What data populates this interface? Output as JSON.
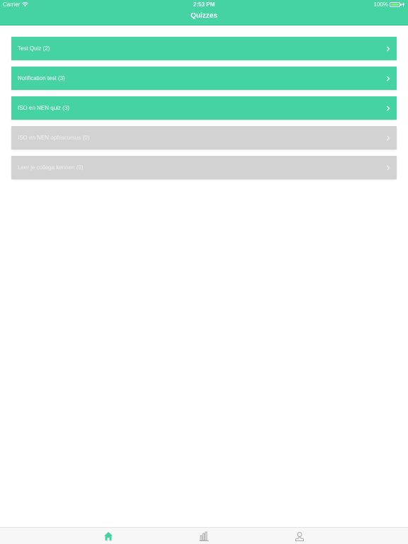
{
  "status_bar": {
    "carrier": "Carrier",
    "time": "2:53 PM",
    "battery": "100%"
  },
  "nav": {
    "title": "Quizzes"
  },
  "quizzes": [
    {
      "label": "Test Quiz (2)",
      "state": "active"
    },
    {
      "label": "Notification test (3)",
      "state": "active"
    },
    {
      "label": "ISO en NEN quiz (3)",
      "state": "active"
    },
    {
      "label": "ISO en NEN opfriscursus (0)",
      "state": "inactive"
    },
    {
      "label": "Leer je collega kennen (0)",
      "state": "inactive"
    }
  ],
  "tabs": [
    {
      "icon": "home-icon",
      "selected": true
    },
    {
      "icon": "bar-chart-icon",
      "selected": false
    },
    {
      "icon": "profile-icon",
      "selected": false
    }
  ],
  "colors": {
    "accent": "#45d3a4",
    "inactive_item": "#d2d2d2",
    "tab_selected": "#45d3a4",
    "tab_unselected": "#a8a8a8"
  }
}
